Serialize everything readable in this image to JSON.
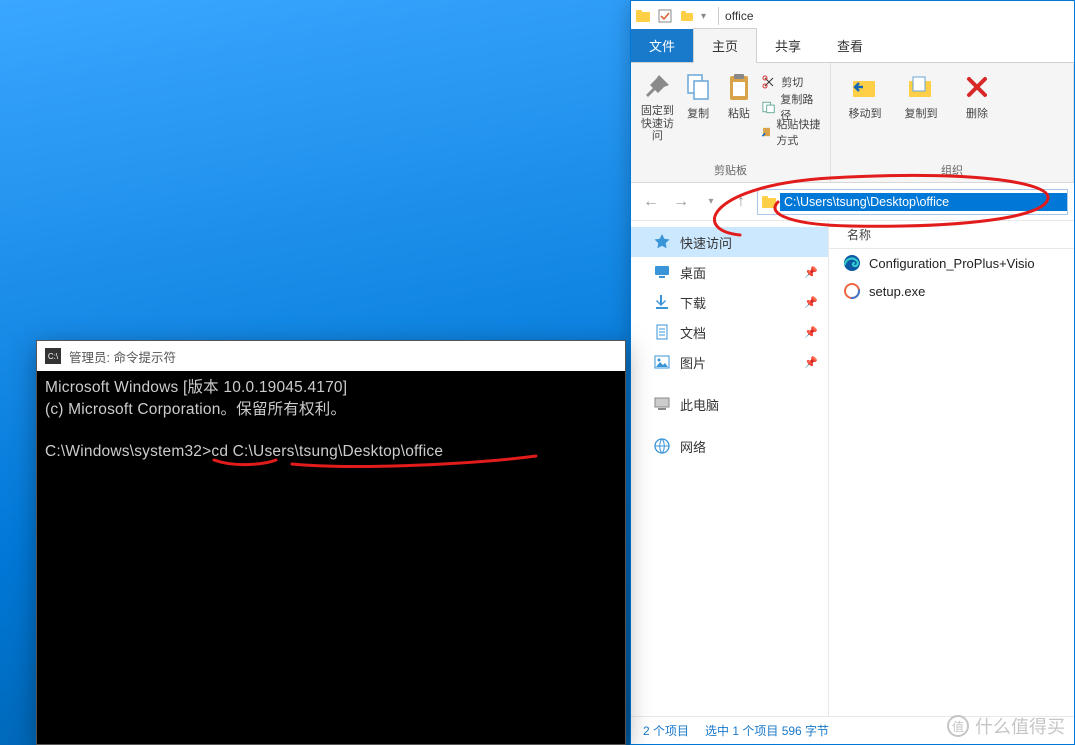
{
  "explorer": {
    "title": "office",
    "tabs": {
      "file": "文件",
      "home": "主页",
      "share": "共享",
      "view": "查看"
    },
    "ribbon": {
      "clipboard": {
        "pin": "固定到\n快速访问",
        "copy": "复制",
        "paste": "粘贴",
        "cut": "剪切",
        "copyPath": "复制路径",
        "pasteShortcut": "粘贴快捷方式",
        "label": "剪贴板"
      },
      "organize": {
        "moveTo": "移动到",
        "copyTo": "复制到",
        "delete": "删除",
        "label": "组织"
      }
    },
    "address": "C:\\Users\\tsung\\Desktop\\office",
    "nav": {
      "quickAccess": "快速访问",
      "desktop": "桌面",
      "downloads": "下载",
      "documents": "文档",
      "pictures": "图片",
      "thisPC": "此电脑",
      "network": "网络"
    },
    "columns": {
      "name": "名称"
    },
    "files": [
      {
        "icon": "edge",
        "name": "Configuration_ProPlus+Visio"
      },
      {
        "icon": "office",
        "name": "setup.exe"
      }
    ],
    "status": {
      "count": "2 个项目",
      "selection": "选中 1 个项目 596 字节"
    }
  },
  "cmd": {
    "title": "管理员: 命令提示符",
    "line1": "Microsoft Windows [版本 10.0.19045.4170]",
    "line2": "(c) Microsoft Corporation。保留所有权利。",
    "prompt": "C:\\Windows\\system32>",
    "command": "cd C:\\Users\\tsung\\Desktop\\office"
  },
  "watermark": "什么值得买"
}
